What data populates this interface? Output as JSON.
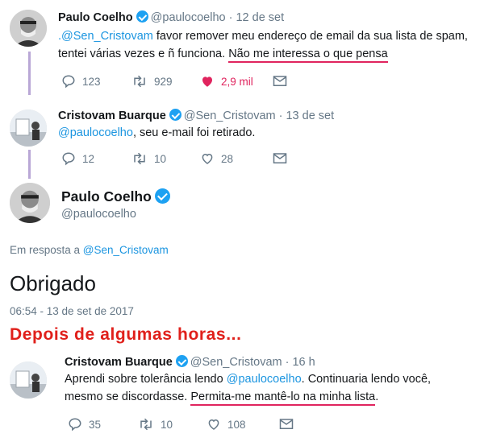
{
  "tweet1": {
    "name": "Paulo Coelho",
    "handle": "@paulocoelho",
    "time": "· 12 de set",
    "mention": ".@Sen_Cristovam",
    "line1_rest": " favor remover meu endereço de email da sua lista de spam,",
    "line2_a": "tentei várias vezes e ñ funciona. ",
    "line2_highlight": "Não me interessa o que pensa",
    "replies": "123",
    "retweets": "929",
    "likes": "2,9 mil"
  },
  "tweet2": {
    "name": "Cristovam Buarque",
    "handle": "@Sen_Cristovam",
    "time": "· 13 de set",
    "mention": "@paulocoelho",
    "text_rest": ", seu e-mail foi retirado.",
    "replies": "12",
    "retweets": "10",
    "likes": "28"
  },
  "tweet3": {
    "name": "Paulo Coelho",
    "handle": "@paulocoelho",
    "reply_prefix": "Em resposta a ",
    "reply_to": "@Sen_Cristovam",
    "body": "Obrigado",
    "timestamp": "06:54 - 13 de set de 2017"
  },
  "caption": "Depois de algumas horas...",
  "tweet4": {
    "name": "Cristovam Buarque",
    "handle": "@Sen_Cristovam",
    "time": "· 16 h",
    "line1_a": "Aprendi sobre tolerância lendo ",
    "line1_mention": "@paulocoelho",
    "line1_b": ". Continuaria lendo você,",
    "line2_a": "mesmo se discordasse. ",
    "line2_highlight": "Permita-me mantê-lo na minha lista",
    "line2_end": ".",
    "replies": "35",
    "retweets": "10",
    "likes": "108"
  },
  "colors": {
    "link": "#1b95e0",
    "muted": "#657786",
    "like_active": "#e0245e",
    "underline": "#e0245e",
    "caption": "#e0201b",
    "verified": "#1da1f2"
  }
}
